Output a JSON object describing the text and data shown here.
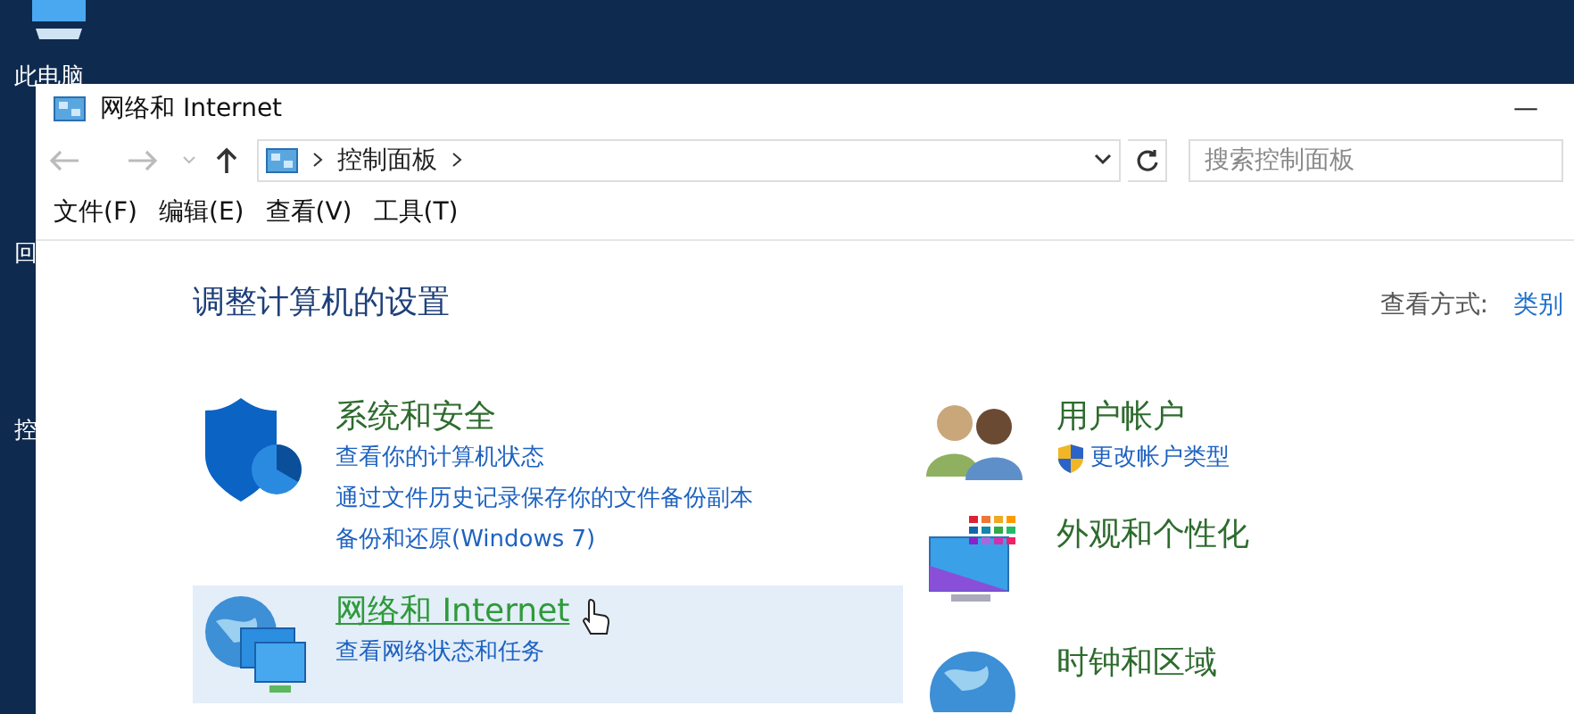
{
  "desktop": {
    "icons": [
      "此电脑",
      "回",
      "控"
    ]
  },
  "window": {
    "title": "网络和 Internet",
    "minimize": "—"
  },
  "address_bar": {
    "path": [
      "控制面板"
    ],
    "search": {
      "placeholder": "搜索控制面板"
    }
  },
  "menu": [
    "文件(F)",
    "编辑(E)",
    "查看(V)",
    "工具(T)"
  ],
  "content": {
    "heading": "调整计算机的设置",
    "view_by_label": "查看方式:",
    "view_by_value": "类别",
    "columns": [
      [
        {
          "title": "系统和安全",
          "highlighted": false,
          "links": [
            {
              "text": "查看你的计算机状态",
              "kind": "plain"
            },
            {
              "text": "通过文件历史记录保存你的文件备份副本",
              "kind": "plain"
            },
            {
              "text": "备份和还原(Windows 7)",
              "kind": "plain"
            }
          ]
        },
        {
          "title": "网络和 Internet",
          "highlighted": true,
          "links": [
            {
              "text": "查看网络状态和任务",
              "kind": "plain"
            }
          ]
        }
      ],
      [
        {
          "title": "用户帐户",
          "highlighted": false,
          "links": [
            {
              "text": "更改帐户类型",
              "kind": "admin"
            }
          ]
        },
        {
          "title": "外观和个性化",
          "highlighted": false
        },
        {
          "title": "时钟和区域",
          "highlighted": false
        }
      ]
    ]
  }
}
